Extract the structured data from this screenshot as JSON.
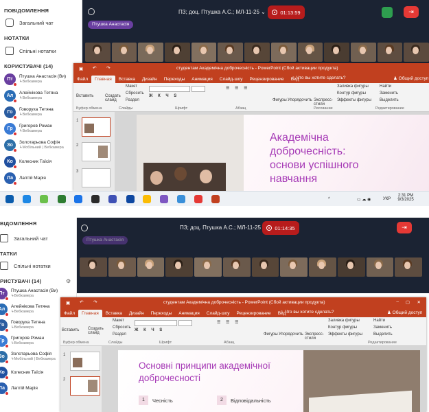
{
  "sidebar": {
    "notifications": "ПОВІДОМЛЕННЯ",
    "chat": "Загальний чат",
    "notes_header": "НОТАТКИ",
    "shared_notes": "Спільні нотатки",
    "users_header": "КОРИСТУВАЧІ (14)",
    "users_header_cut": "РИСТУВАЧІ (14)",
    "notifications_cut": "ВІДОМЛЕННЯ",
    "notes_cut": "ТАТКИ",
    "users": [
      {
        "initials": "Пт",
        "name": "Птушка Анастасія (Ви)",
        "sub": "Вебкамера",
        "color": "#6a3fa0"
      },
      {
        "initials": "Ал",
        "name": "Алейнікова Тетяна",
        "sub": "Вебкамера",
        "color": "#2a6db5"
      },
      {
        "initials": "Го",
        "name": "Говоруха Тетяна",
        "sub": "Вебкамера",
        "color": "#2a5ca0"
      },
      {
        "initials": "Гр",
        "name": "Григоров Роман",
        "sub": "Вебкамера",
        "color": "#3a7bd5"
      },
      {
        "initials": "Зо",
        "name": "Золотарьова Софія",
        "sub": "Мобільний | Вебкамера",
        "color": "#2d6fa8"
      },
      {
        "initials": "Ко",
        "name": "Колесник Таїсія",
        "sub": "",
        "color": "#2050a0"
      },
      {
        "initials": "Ла",
        "name": "Лаптій Марія",
        "sub": "",
        "color": "#2a60b0"
      }
    ]
  },
  "conference": {
    "title": "ПЗ; доц. Птушка А.С.; МЛ-11-25",
    "timer1": "01:13:59",
    "timer2": "01:14:35",
    "presenter": "Птушка Анастасія"
  },
  "ppt": {
    "title": "студентам Академічна доброчесність - PowerPoint (Сбой активации продукта)",
    "tabs": [
      "Файл",
      "Главная",
      "Вставка",
      "Дизайн",
      "Переходы",
      "Анимация",
      "Слайд-шоу",
      "Рецензирование",
      "Вид"
    ],
    "search": "Что вы хотите сделать?",
    "share": "Общий доступ",
    "groups": {
      "clipboard": "Буфер обмена",
      "slides": "Слайды",
      "font": "Шрифт",
      "paragraph": "Абзац",
      "drawing": "Рисование",
      "editing": "Редактирование"
    },
    "buttons": {
      "paste": "Вставить",
      "create": "Создать слайд",
      "layout": "Макет",
      "reset": "Сбросить",
      "section": "Раздел",
      "shapes": "Фигуры",
      "arrange": "Упорядочить",
      "styles": "Экспресс-стили",
      "fill": "Заливка фигуры",
      "outline": "Контур фигуры",
      "effects": "Эффекты фигуры",
      "find": "Найти",
      "replace": "Заменить",
      "select": "Выделить"
    },
    "slide1": {
      "line1": "Академічна",
      "line2": "доброчесність:",
      "line3": "основи успішного",
      "line4": "навчання"
    },
    "slide2": {
      "title1": "Основні принципи академічної",
      "title2": "доброчесності",
      "n1": "1",
      "p1": "Чесність",
      "n2": "2",
      "p2": "Відповідальність"
    },
    "thumb_nums": [
      "1",
      "2",
      "3"
    ]
  },
  "taskbar": {
    "lang": "УКР",
    "time": "2:31 PM",
    "date": "9/3/2025"
  }
}
